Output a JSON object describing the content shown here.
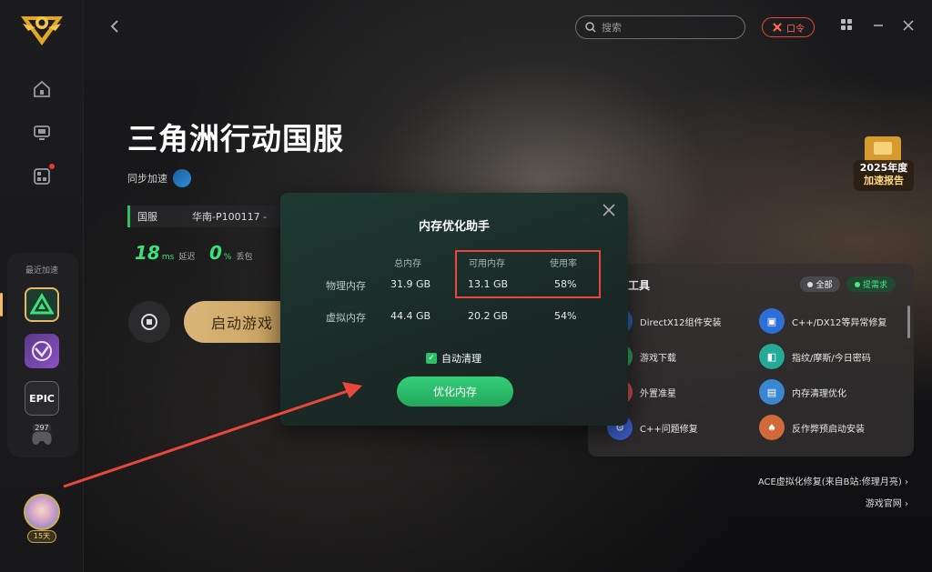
{
  "header": {
    "search_placeholder": "搜索",
    "command_label": "口令"
  },
  "game": {
    "title": "三角洲行动国服",
    "sync_label": "同步加速",
    "server_region": "国服",
    "server_node": "华南-P100117 -",
    "latency_value": "18",
    "latency_unit": "ms",
    "latency_label": "延迟",
    "loss_value": "0",
    "loss_unit": "%",
    "loss_label": "丢包",
    "start_label": "启动游戏"
  },
  "sidebar": {
    "recent_label": "最近加速",
    "days_badge": "15天",
    "game_tile_epic_text": "EPIC",
    "game_tile_count": "297"
  },
  "report_badge": {
    "line1": "2025年度",
    "line2": "加速报告"
  },
  "tools": {
    "title": "工具",
    "all_label": "全部",
    "request_label": "提需求",
    "items": [
      {
        "label": "DirectX12组件安装",
        "icon": "directx-icon"
      },
      {
        "label": "C++/DX12等异常修复",
        "icon": "folder-fix-icon"
      },
      {
        "label": "游戏下载",
        "icon": "download-icon"
      },
      {
        "label": "指纹/摩斯/今日密码",
        "icon": "password-icon"
      },
      {
        "label": "外置准星",
        "icon": "crosshair-icon"
      },
      {
        "label": "内存清理优化",
        "icon": "memory-icon"
      },
      {
        "label": "C++问题修复",
        "icon": "wrench-icon"
      },
      {
        "label": "反作弊预启动安装",
        "icon": "shield-card-icon"
      }
    ],
    "footer_links": [
      "ACE虚拟化修复(来自B站:修理月亮)",
      "游戏官网"
    ]
  },
  "modal": {
    "title": "内存优化助手",
    "columns": [
      "总内存",
      "可用内存",
      "使用率"
    ],
    "rows": [
      {
        "label": "物理内存",
        "total": "31.9 GB",
        "available": "13.1 GB",
        "usage": "58%"
      },
      {
        "label": "虚拟内存",
        "total": "44.4 GB",
        "available": "20.2 GB",
        "usage": "54%"
      }
    ],
    "auto_clean_label": "自动清理",
    "optimize_label": "优化内存"
  },
  "colors": {
    "accent_green": "#2fbf6b",
    "annotation_red": "#e8483c",
    "gold": "#d9b77a"
  }
}
